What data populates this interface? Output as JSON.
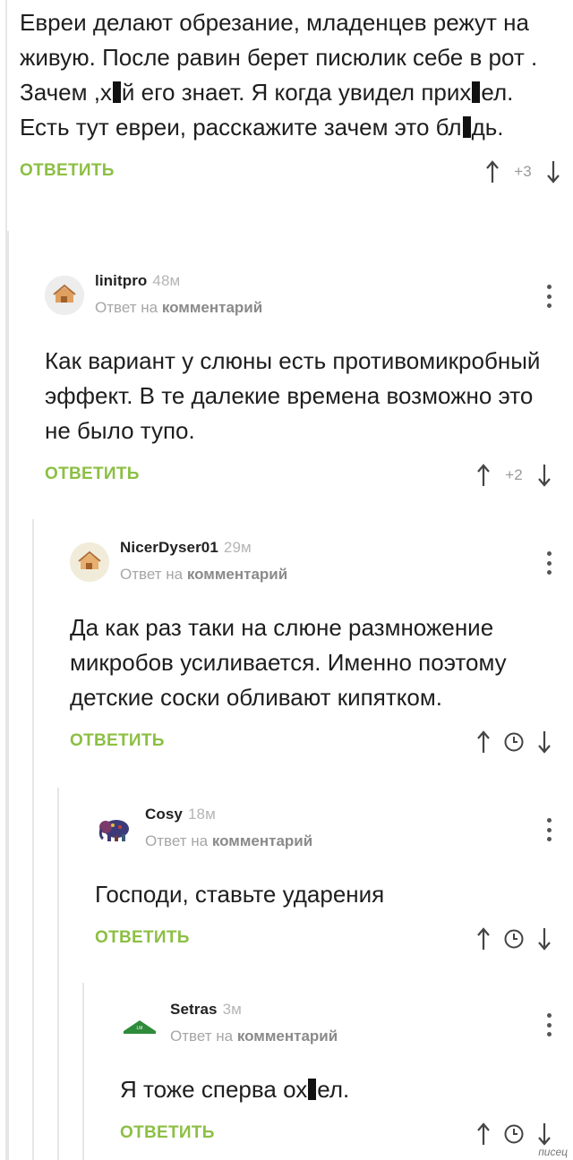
{
  "root_comment": {
    "text_parts": [
      "Евреи делают обрезание, младенцев режут на живую. После равин берет писюлик себе в рот . Зачем ,х",
      "й его знает.  Я когда увидел прих",
      "ел. Есть тут евреи, расскажите зачем это бл",
      "дь."
    ],
    "reply_label": "ОТВЕТИТЬ",
    "score": "+3"
  },
  "comments": [
    {
      "username": "linitpro",
      "time": "48м",
      "reply_prefix": "Ответ на",
      "reply_target": "комментарий",
      "text": "Как вариант у слюны есть противомикробный эффект. В те далекие времена возможно это не было тупо.",
      "reply_label": "ОТВЕТИТЬ",
      "score": "+2",
      "avatar_icon": "house-avatar-icon"
    },
    {
      "username": "NicerDyser01",
      "time": "29м",
      "reply_prefix": "Ответ на",
      "reply_target": "комментарий",
      "text": "Да как раз таки на слюне размножение микробов усиливается.  Именно поэтому детские соски обливают кипятком.",
      "reply_label": "ОТВЕТИТЬ",
      "score_icon": "clock-icon",
      "avatar_icon": "house-avatar-icon"
    },
    {
      "username": "Cosy",
      "time": "18м",
      "reply_prefix": "Ответ на",
      "reply_target": "комментарий",
      "text": "Господи, ставьте ударения",
      "reply_label": "ОТВЕТИТЬ",
      "score_icon": "clock-icon",
      "avatar_icon": "elephant-avatar-icon"
    },
    {
      "username": "Setras",
      "time": "3м",
      "reply_prefix": "Ответ на",
      "reply_target": "комментарий",
      "text_parts": [
        "Я тоже сперва ох",
        "ел."
      ],
      "reply_label": "ОТВЕТИТЬ",
      "score_icon": "clock-icon",
      "avatar_icon": "logo-avatar-icon"
    }
  ],
  "colors": {
    "accent_green": "#8cbf43",
    "thread_line": "#e6e6e6",
    "meta_gray": "#a6a6a6"
  },
  "watermark": "писец"
}
